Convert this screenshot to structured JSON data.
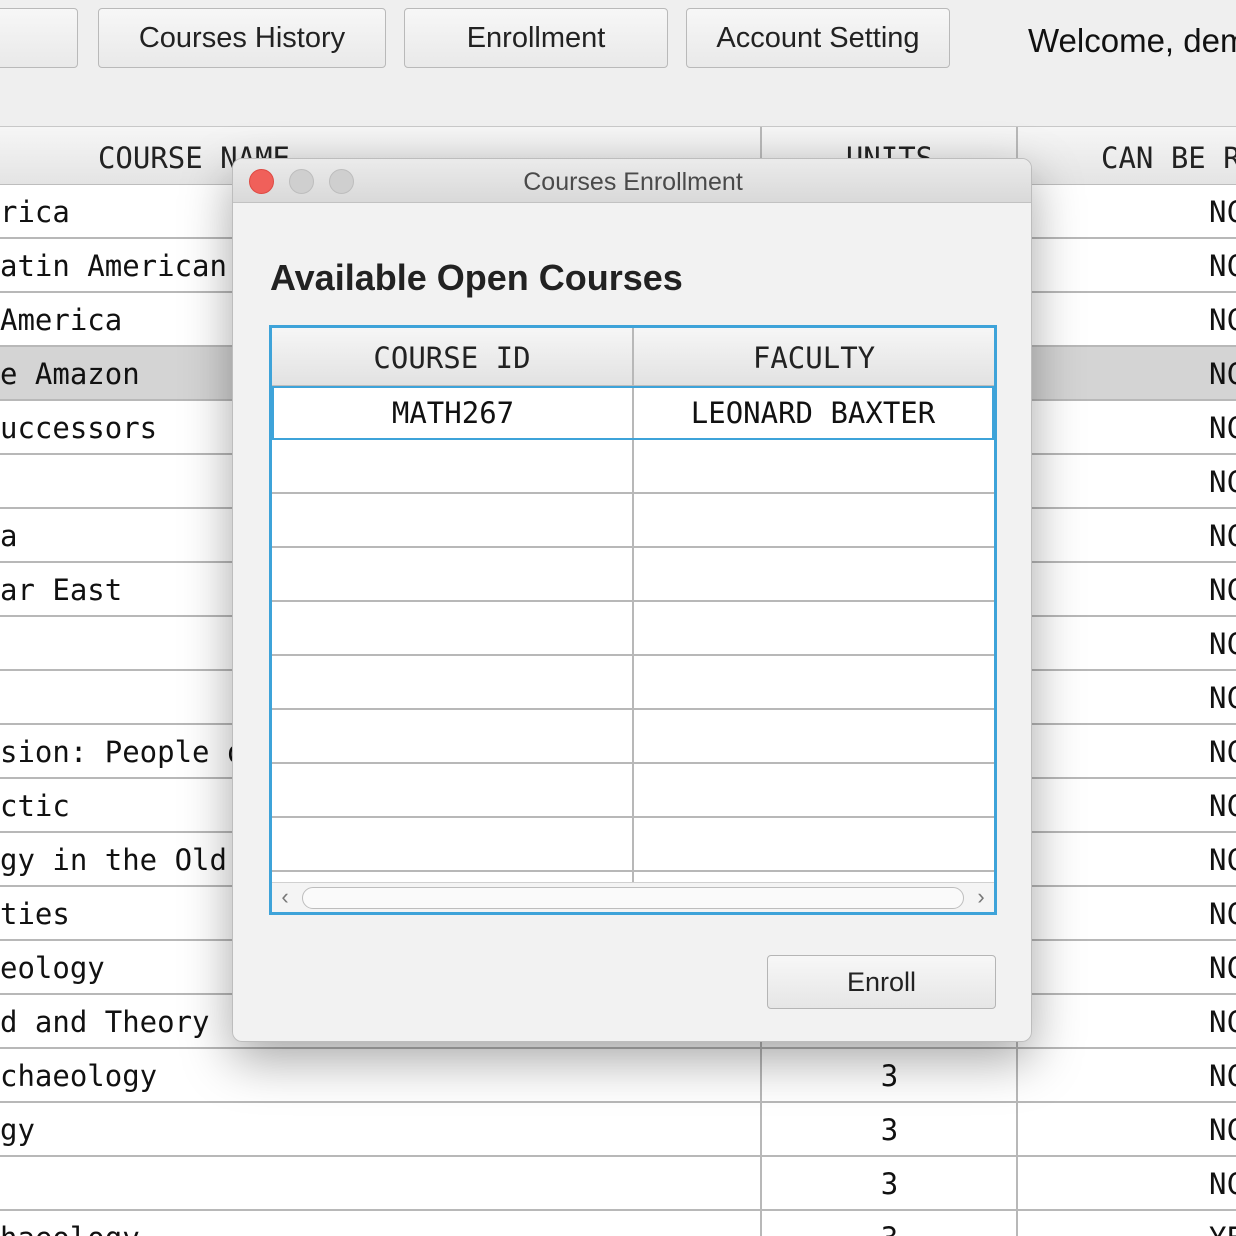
{
  "toolbar": {
    "buttons": [
      {
        "label": ""
      },
      {
        "label": "Courses History"
      },
      {
        "label": "Enrollment"
      },
      {
        "label": "Account Setting"
      }
    ],
    "welcome": "Welcome, dem"
  },
  "background_table": {
    "headers": [
      "COURSE NAME",
      "UNITS",
      "CAN BE R"
    ],
    "rows": [
      {
        "name": "rica",
        "units": "",
        "can": "NC"
      },
      {
        "name": "atin American",
        "units": "",
        "can": "NC"
      },
      {
        "name": "America",
        "units": "",
        "can": "NC"
      },
      {
        "name": "e Amazon",
        "units": "",
        "can": "NC"
      },
      {
        "name": "uccessors",
        "units": "",
        "can": "NC"
      },
      {
        "name": "",
        "units": "",
        "can": "NC"
      },
      {
        "name": "a",
        "units": "",
        "can": "NC"
      },
      {
        "name": "ar East",
        "units": "",
        "can": "NC"
      },
      {
        "name": "",
        "units": "",
        "can": "NC"
      },
      {
        "name": "",
        "units": "",
        "can": "NC"
      },
      {
        "name": "sion: People o",
        "units": "",
        "can": "NC"
      },
      {
        "name": "ctic",
        "units": "",
        "can": "NC"
      },
      {
        "name": "gy in the Old",
        "units": "",
        "can": "NC"
      },
      {
        "name": "ties",
        "units": "",
        "can": "NC"
      },
      {
        "name": "eology",
        "units": "",
        "can": "NC"
      },
      {
        "name": "d and Theory",
        "units": "",
        "can": "NC"
      },
      {
        "name": "chaeology",
        "units": "3",
        "can": "NC"
      },
      {
        "name": "gy",
        "units": "3",
        "can": "NC"
      },
      {
        "name": "",
        "units": "3",
        "can": "NC"
      },
      {
        "name": "haeology",
        "units": "3",
        "can": "YE"
      }
    ]
  },
  "modal": {
    "title": "Courses Enrollment",
    "heading": "Available Open Courses",
    "table": {
      "headers": [
        "COURSE ID",
        "FACULTY"
      ],
      "rows": [
        {
          "course_id": "MATH267",
          "faculty": "LEONARD BAXTER"
        }
      ],
      "empty_rows": 8
    },
    "enroll_label": "Enroll",
    "scroll_left": "‹",
    "scroll_right": "›"
  }
}
